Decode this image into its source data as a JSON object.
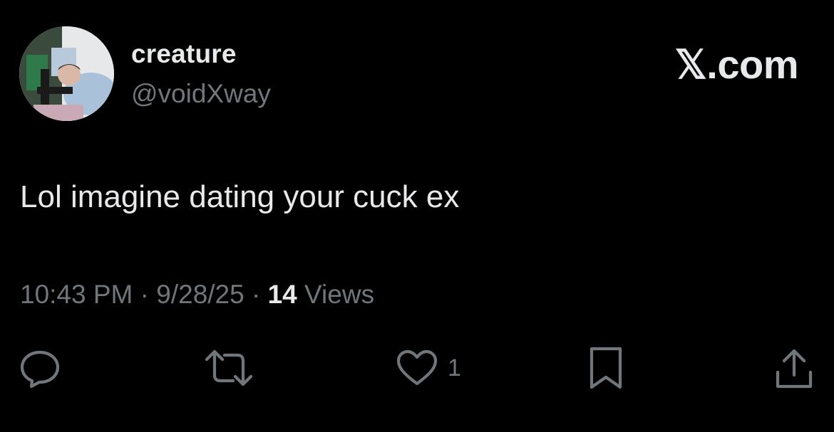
{
  "tweet": {
    "display_name": "creature",
    "handle": "@voidXway",
    "brand": "𝕏.com",
    "text": "Lol imagine dating your cuck ex",
    "time": "10:43 PM",
    "separator": "·",
    "date": "9/28/25",
    "views_count": "14",
    "views_label": "Views"
  },
  "actions": {
    "reply_icon": "reply-icon",
    "retweet_icon": "retweet-icon",
    "like_icon": "heart-icon",
    "like_count": "1",
    "bookmark_icon": "bookmark-icon",
    "share_icon": "share-icon"
  },
  "colors": {
    "background": "#000000",
    "primary_text": "#e7e9ea",
    "secondary_text": "#71767b"
  }
}
